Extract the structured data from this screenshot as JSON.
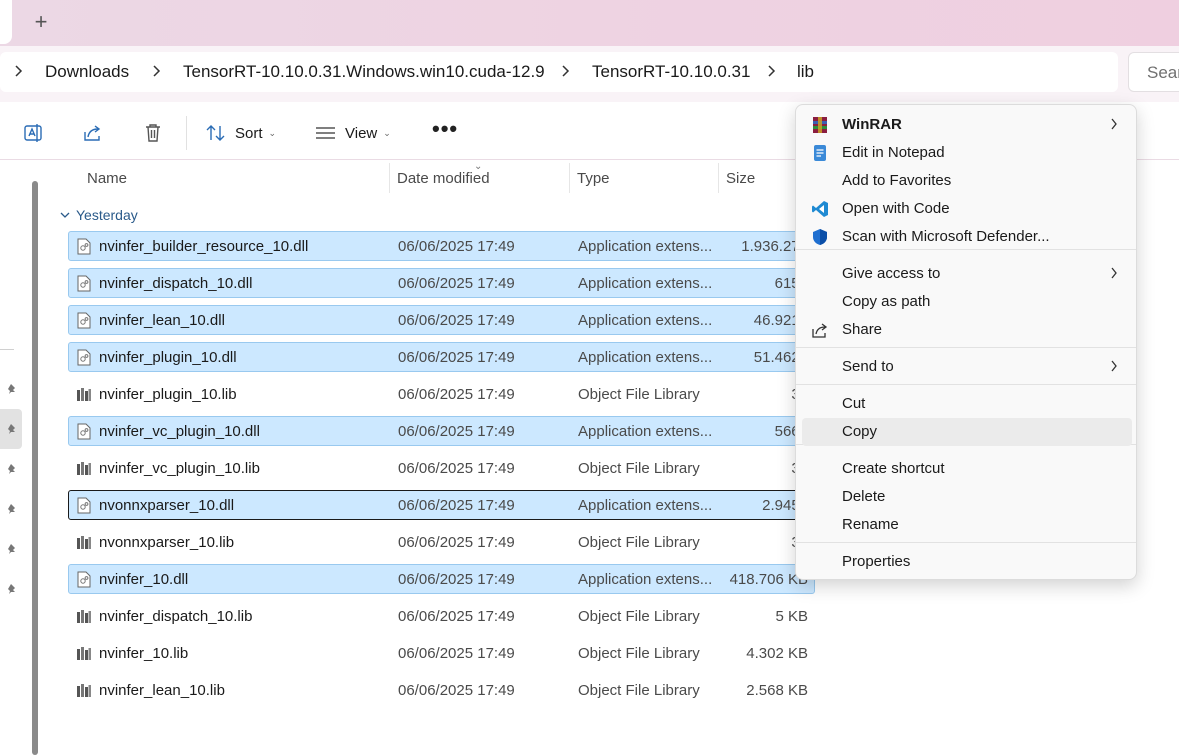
{
  "titlebar": {
    "new_tab_glyph": "+"
  },
  "breadcrumbs": [
    "Downloads",
    "TensorRT-10.10.0.31.Windows.win10.cuda-12.9",
    "TensorRT-10.10.0.31",
    "lib"
  ],
  "search": {
    "placeholder": "Sear"
  },
  "toolbar": {
    "sort_label": "Sort",
    "view_label": "View",
    "more_label": "•••"
  },
  "columns": {
    "name": "Name",
    "date": "Date modified",
    "type": "Type",
    "size": "Size"
  },
  "group_label": "Yesterday",
  "files": [
    {
      "name": "nvinfer_builder_resource_10.dll",
      "date": "06/06/2025 17:49",
      "type": "Application extens...",
      "size": "1.936.270",
      "selected": true,
      "focus": false,
      "kind": "dll"
    },
    {
      "name": "nvinfer_dispatch_10.dll",
      "date": "06/06/2025 17:49",
      "type": "Application extens...",
      "size": "615 I",
      "selected": true,
      "focus": false,
      "kind": "dll"
    },
    {
      "name": "nvinfer_lean_10.dll",
      "date": "06/06/2025 17:49",
      "type": "Application extens...",
      "size": "46.921 I",
      "selected": true,
      "focus": false,
      "kind": "dll"
    },
    {
      "name": "nvinfer_plugin_10.dll",
      "date": "06/06/2025 17:49",
      "type": "Application extens...",
      "size": "51.462 I",
      "selected": true,
      "focus": false,
      "kind": "dll"
    },
    {
      "name": "nvinfer_plugin_10.lib",
      "date": "06/06/2025 17:49",
      "type": "Object File Library",
      "size": "3 I",
      "selected": false,
      "focus": false,
      "kind": "lib"
    },
    {
      "name": "nvinfer_vc_plugin_10.dll",
      "date": "06/06/2025 17:49",
      "type": "Application extens...",
      "size": "566 I",
      "selected": true,
      "focus": false,
      "kind": "dll"
    },
    {
      "name": "nvinfer_vc_plugin_10.lib",
      "date": "06/06/2025 17:49",
      "type": "Object File Library",
      "size": "3 I",
      "selected": false,
      "focus": false,
      "kind": "lib"
    },
    {
      "name": "nvonnxparser_10.dll",
      "date": "06/06/2025 17:49",
      "type": "Application extens...",
      "size": "2.945 I",
      "selected": true,
      "focus": true,
      "kind": "dll"
    },
    {
      "name": "nvonnxparser_10.lib",
      "date": "06/06/2025 17:49",
      "type": "Object File Library",
      "size": "3 I",
      "selected": false,
      "focus": false,
      "kind": "lib"
    },
    {
      "name": "nvinfer_10.dll",
      "date": "06/06/2025 17:49",
      "type": "Application extens...",
      "size": "418.706 KB",
      "selected": true,
      "focus": false,
      "kind": "dll"
    },
    {
      "name": "nvinfer_dispatch_10.lib",
      "date": "06/06/2025 17:49",
      "type": "Object File Library",
      "size": "5 KB",
      "selected": false,
      "focus": false,
      "kind": "lib"
    },
    {
      "name": "nvinfer_10.lib",
      "date": "06/06/2025 17:49",
      "type": "Object File Library",
      "size": "4.302 KB",
      "selected": false,
      "focus": false,
      "kind": "lib"
    },
    {
      "name": "nvinfer_lean_10.lib",
      "date": "06/06/2025 17:49",
      "type": "Object File Library",
      "size": "2.568 KB",
      "selected": false,
      "focus": false,
      "kind": "lib"
    }
  ],
  "context_menu": {
    "items": [
      {
        "label": "WinRAR",
        "icon": "winrar-icon",
        "submenu": true,
        "bold": true
      },
      {
        "label": "Edit in Notepad",
        "icon": "notepad-icon",
        "submenu": false,
        "bold": false
      },
      {
        "label": "Add to Favorites",
        "icon": "",
        "submenu": false,
        "bold": false
      },
      {
        "label": "Open with Code",
        "icon": "vscode-icon",
        "submenu": false,
        "bold": false
      },
      {
        "label": "Scan with Microsoft Defender...",
        "icon": "defender-shield-icon",
        "submenu": false,
        "bold": false
      },
      {
        "label": "Give access to",
        "icon": "",
        "submenu": true,
        "bold": false
      },
      {
        "label": "Copy as path",
        "icon": "",
        "submenu": false,
        "bold": false
      },
      {
        "label": "Share",
        "icon": "share-icon",
        "submenu": false,
        "bold": false
      },
      {
        "label": "Send to",
        "icon": "",
        "submenu": true,
        "bold": false
      },
      {
        "label": "Cut",
        "icon": "",
        "submenu": false,
        "bold": false
      },
      {
        "label": "Copy",
        "icon": "",
        "submenu": false,
        "bold": false,
        "hover": true
      },
      {
        "label": "Create shortcut",
        "icon": "",
        "submenu": false,
        "bold": false
      },
      {
        "label": "Delete",
        "icon": "",
        "submenu": false,
        "bold": false
      },
      {
        "label": "Rename",
        "icon": "",
        "submenu": false,
        "bold": false
      },
      {
        "label": "Properties",
        "icon": "",
        "submenu": false,
        "bold": false
      }
    ]
  },
  "colors": {
    "selection": "#cce8ff",
    "selection_border": "#99c9ef",
    "group_text": "#2a5a8a",
    "titlebar": "#eed3e2"
  }
}
